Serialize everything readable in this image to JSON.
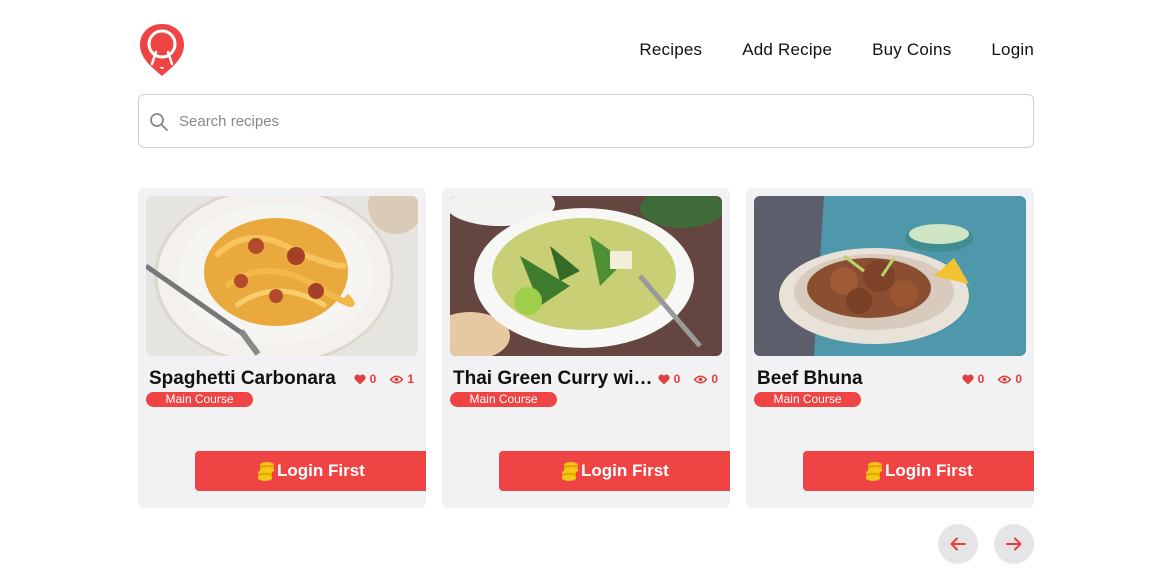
{
  "brand": {
    "logo_icon": "map-pin-spoon-fork-icon",
    "accent": "#ef4444"
  },
  "nav": {
    "items": [
      {
        "label": "Recipes"
      },
      {
        "label": "Add Recipe"
      },
      {
        "label": "Buy Coins"
      },
      {
        "label": "Login"
      }
    ]
  },
  "search": {
    "placeholder": "Search recipes",
    "value": "",
    "icon": "search-icon"
  },
  "recipes": [
    {
      "title": "Spaghetti Carbonara",
      "likes": "0",
      "views": "1",
      "category": "Main Course",
      "button": "Login First"
    },
    {
      "title": "Thai Green Curry with Tofu",
      "likes": "0",
      "views": "0",
      "category": "Main Course",
      "button": "Login First"
    },
    {
      "title": "Beef Bhuna",
      "likes": "0",
      "views": "0",
      "category": "Main Course",
      "button": "Login First"
    }
  ],
  "pager": {
    "prev_icon": "arrow-left-icon",
    "next_icon": "arrow-right-icon"
  }
}
